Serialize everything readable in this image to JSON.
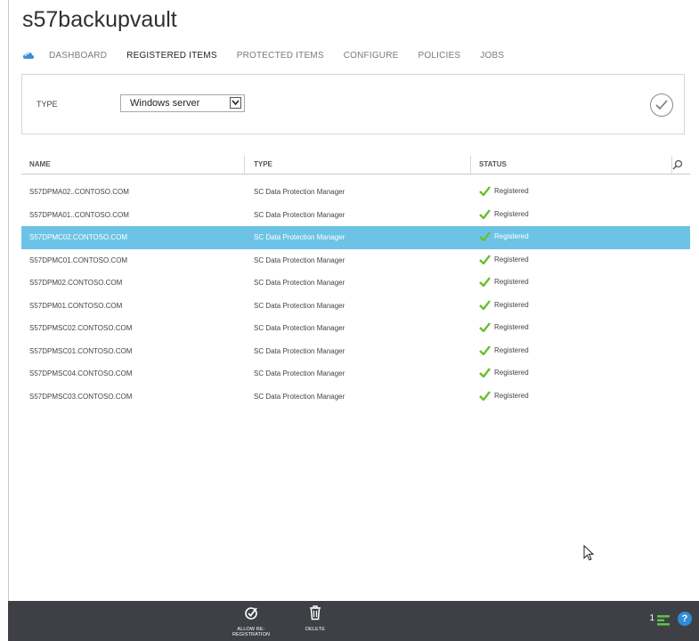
{
  "vault": {
    "title": "s57backupvault"
  },
  "nav": {
    "tabs": [
      {
        "label": "DASHBOARD",
        "active": false
      },
      {
        "label": "REGISTERED ITEMS",
        "active": true
      },
      {
        "label": "PROTECTED ITEMS",
        "active": false
      },
      {
        "label": "CONFIGURE",
        "active": false
      },
      {
        "label": "POLICIES",
        "active": false
      },
      {
        "label": "JOBS",
        "active": false
      }
    ]
  },
  "filter": {
    "type_label": "TYPE",
    "type_value": "Windows server"
  },
  "table": {
    "columns": [
      "NAME",
      "TYPE",
      "STATUS"
    ],
    "rows": [
      {
        "name": "S57DPMA02..CONTOSO.COM",
        "type": "SC Data Protection Manager",
        "status": "Registered",
        "selected": false
      },
      {
        "name": "S57DPMA01..CONTOSO.COM",
        "type": "SC Data Protection Manager",
        "status": "Registered",
        "selected": false
      },
      {
        "name": "S57DPMC02.CONTOSO.COM",
        "type": "SC Data Protection Manager",
        "status": "Registered",
        "selected": true
      },
      {
        "name": "S57DPMC01.CONTOSO.COM",
        "type": "SC Data Protection Manager",
        "status": "Registered",
        "selected": false
      },
      {
        "name": "S57DPM02.CONTOSO.COM",
        "type": "SC Data Protection Manager",
        "status": "Registered",
        "selected": false
      },
      {
        "name": "S57DPM01.CONTOSO.COM",
        "type": "SC Data Protection Manager",
        "status": "Registered",
        "selected": false
      },
      {
        "name": "S57DPMSC02.CONTOSO.COM",
        "type": "SC Data Protection Manager",
        "status": "Registered",
        "selected": false
      },
      {
        "name": "S57DPMSC01.CONTOSO.COM",
        "type": "SC Data Protection Manager",
        "status": "Registered",
        "selected": false
      },
      {
        "name": "S57DPMSC04.CONTOSO.COM",
        "type": "SC Data Protection Manager",
        "status": "Registered",
        "selected": false
      },
      {
        "name": "S57DPMSC03.CONTOSO.COM",
        "type": "SC Data Protection Manager",
        "status": "Registered",
        "selected": false
      }
    ]
  },
  "commands": {
    "allow_reregistration": "ALLOW RE-REGISTRATION",
    "delete": "DELETE"
  },
  "status_bar": {
    "count": "1"
  },
  "colors": {
    "selected_row": "#6cc3e6",
    "registered_check": "#6abf2e",
    "command_bar": "#3e4046",
    "help": "#2f8dd6"
  },
  "icons": {
    "nav": "cloud-icon",
    "filter_confirm": "checkmark-circle-icon",
    "search": "search-icon",
    "status": "checkmark-icon",
    "allow_reregistration": "reregister-icon",
    "delete": "trash-icon",
    "help": "help-icon"
  }
}
